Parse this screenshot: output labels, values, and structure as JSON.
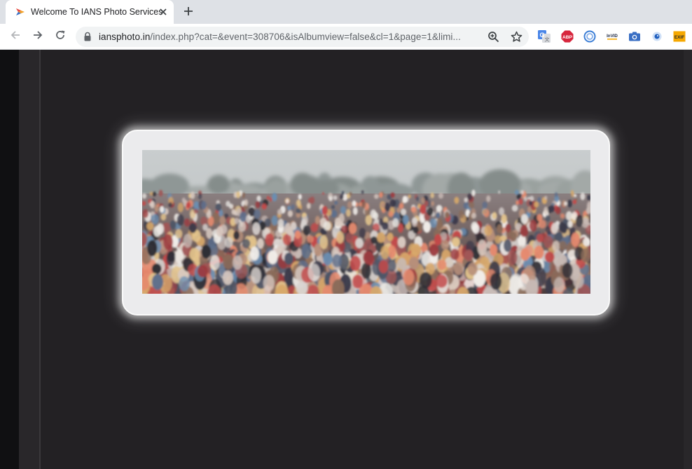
{
  "browser": {
    "tab": {
      "title": "Welcome To IANS Photo Services",
      "favicon": "ians-logo-icon"
    },
    "new_tab_icon": "plus-icon",
    "nav": {
      "back_icon": "arrow-left-icon",
      "forward_icon": "arrow-right-icon",
      "reload_icon": "reload-icon"
    },
    "address_bar": {
      "host": "iansphoto.in",
      "path": "/index.php?cat=&event=308706&isAlbumview=false&cl=1&page=1&limi..."
    },
    "extensions": [
      {
        "name": "google-translate-icon",
        "label": "G"
      },
      {
        "name": "adblock-plus-icon",
        "label": "ABP"
      },
      {
        "name": "ring-extension-icon",
        "label": ""
      },
      {
        "name": "invid-icon",
        "label": "InVID"
      },
      {
        "name": "camera-icon",
        "label": ""
      },
      {
        "name": "eye-icon",
        "label": ""
      },
      {
        "name": "exif-icon",
        "label": "EXIF"
      }
    ]
  },
  "page": {
    "lightbox": {
      "image": "crowd-photo",
      "alt": ""
    }
  },
  "colors": {
    "page_background": "#232124",
    "lightbox_frame": "#ebebed",
    "tabstrip": "#dee1e6",
    "adblock_red": "#d7263d",
    "exif_yellow": "#f6a800"
  }
}
